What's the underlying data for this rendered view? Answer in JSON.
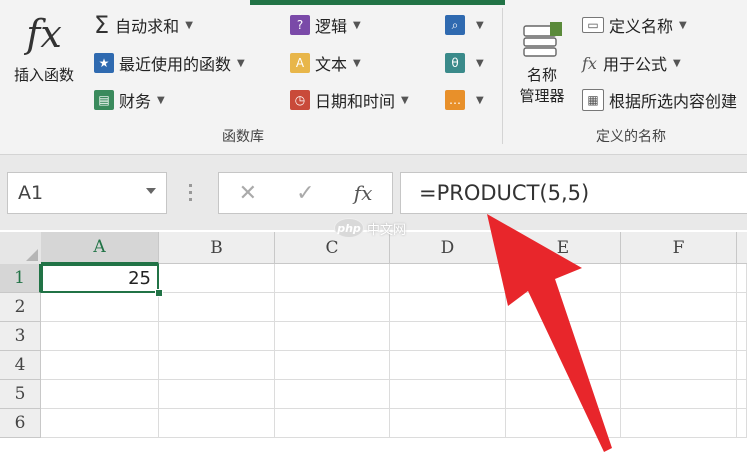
{
  "ribbon": {
    "insert_function": "插入函数",
    "insert_function_symbol": "fx",
    "items": {
      "autosum": "自动求和",
      "recent": "最近使用的函数",
      "financial": "财务",
      "logical": "逻辑",
      "text": "文本",
      "datetime": "日期和时间",
      "define_name": "定义名称",
      "use_in_formula": "用于公式",
      "create_from_selection": "根据所选内容创建"
    },
    "name_manager_line1": "名称",
    "name_manager_line2": "管理器",
    "group_function_library": "函数库",
    "group_defined_names": "定义的名称"
  },
  "formula_bar": {
    "name_box": "A1",
    "cancel": "✕",
    "enter": "✓",
    "fx": "fx",
    "formula": "=PRODUCT(5,5)"
  },
  "sheet": {
    "columns": [
      "A",
      "B",
      "C",
      "D",
      "E",
      "F"
    ],
    "rows": [
      "1",
      "2",
      "3",
      "4",
      "5",
      "6"
    ],
    "active_cell_value": "25"
  },
  "watermark": {
    "logo": "php",
    "text": "中文网"
  },
  "colors": {
    "excel_green": "#217346",
    "arrow_red": "#e8262b"
  }
}
